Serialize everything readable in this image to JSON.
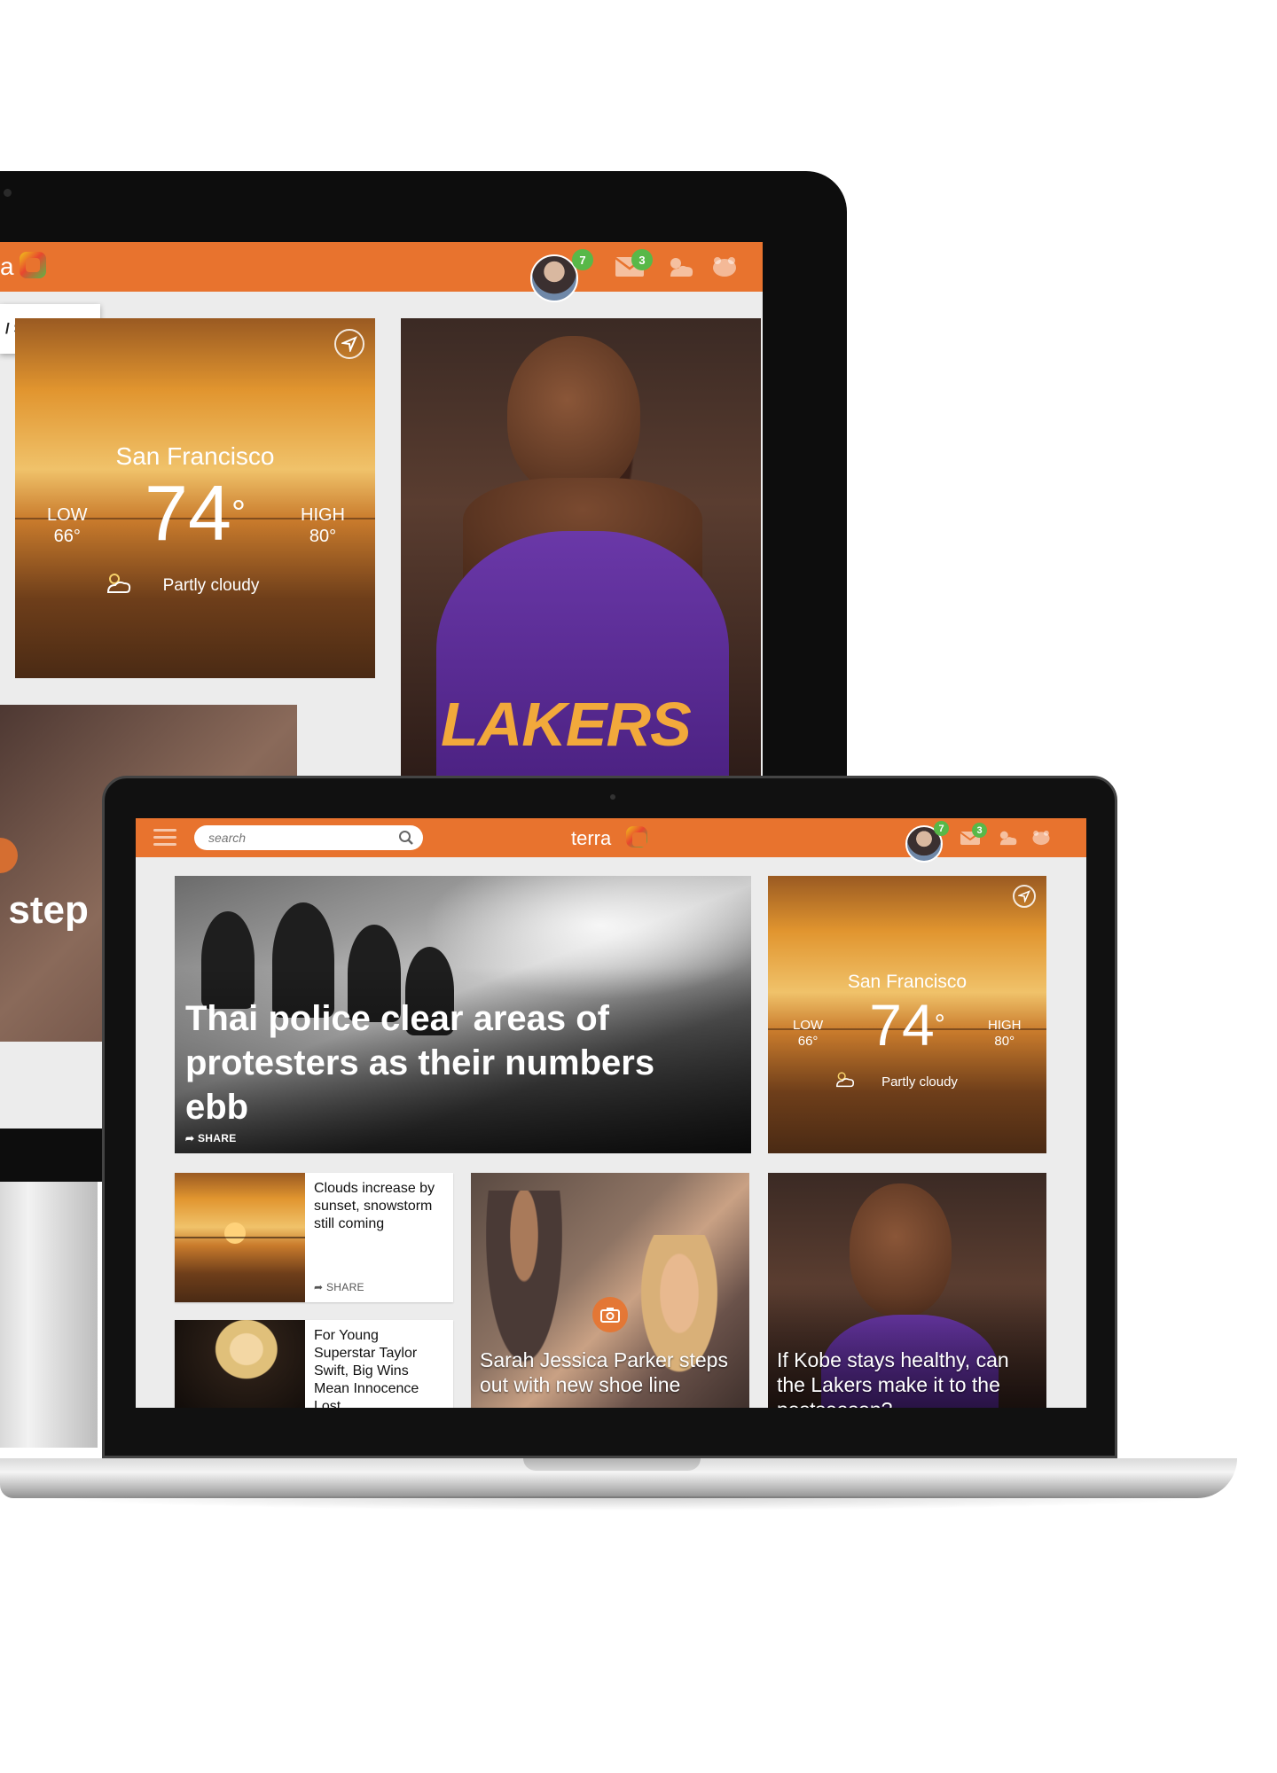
{
  "brand": {
    "name": "terra",
    "accent": "#e8732e",
    "badge_color": "#58b848"
  },
  "monitor": {
    "logo_partial": "a",
    "notifications": {
      "avatar_badge": "7",
      "mail_badge": "3"
    },
    "stories_tab": "/ STORIES",
    "weather": {
      "city": "San Francisco",
      "temp": "74",
      "degree": "°",
      "low_label": "LOW",
      "low_value": "66°",
      "high_label": "HIGH",
      "high_value": "80°",
      "condition": "Partly cloudy"
    },
    "kobe_jersey": "LAKERS",
    "lower_story_partial": "r step"
  },
  "laptop": {
    "search": {
      "placeholder": "search"
    },
    "logo_text": "terra",
    "notifications": {
      "avatar_badge": "7",
      "mail_badge": "3"
    },
    "lead_story": {
      "title": "Thai police clear areas of protesters as their numbers ebb",
      "share": "SHARE"
    },
    "weather": {
      "city": "San Francisco",
      "temp": "74",
      "degree": "°",
      "low_label": "LOW",
      "low_value": "66°",
      "high_label": "HIGH",
      "high_value": "80°",
      "condition": "Partly cloudy"
    },
    "small_stories": [
      {
        "title": "Clouds increase by sunset, snowstorm still coming",
        "share": "SHARE"
      },
      {
        "title": "For Young Superstar Taylor Swift, Big Wins Mean Innocence Lost"
      }
    ],
    "photo_stories": [
      {
        "title": "Sarah Jessica Parker steps out with new shoe line"
      },
      {
        "title": "If Kobe stays healthy, can the Lakers make it to the postseason?"
      }
    ]
  },
  "icons": [
    "location-arrow-icon",
    "mail-icon",
    "weather-icon",
    "horoscope-icon",
    "menu-icon",
    "search-icon",
    "share-icon",
    "camera-icon",
    "partly-cloudy-icon"
  ]
}
